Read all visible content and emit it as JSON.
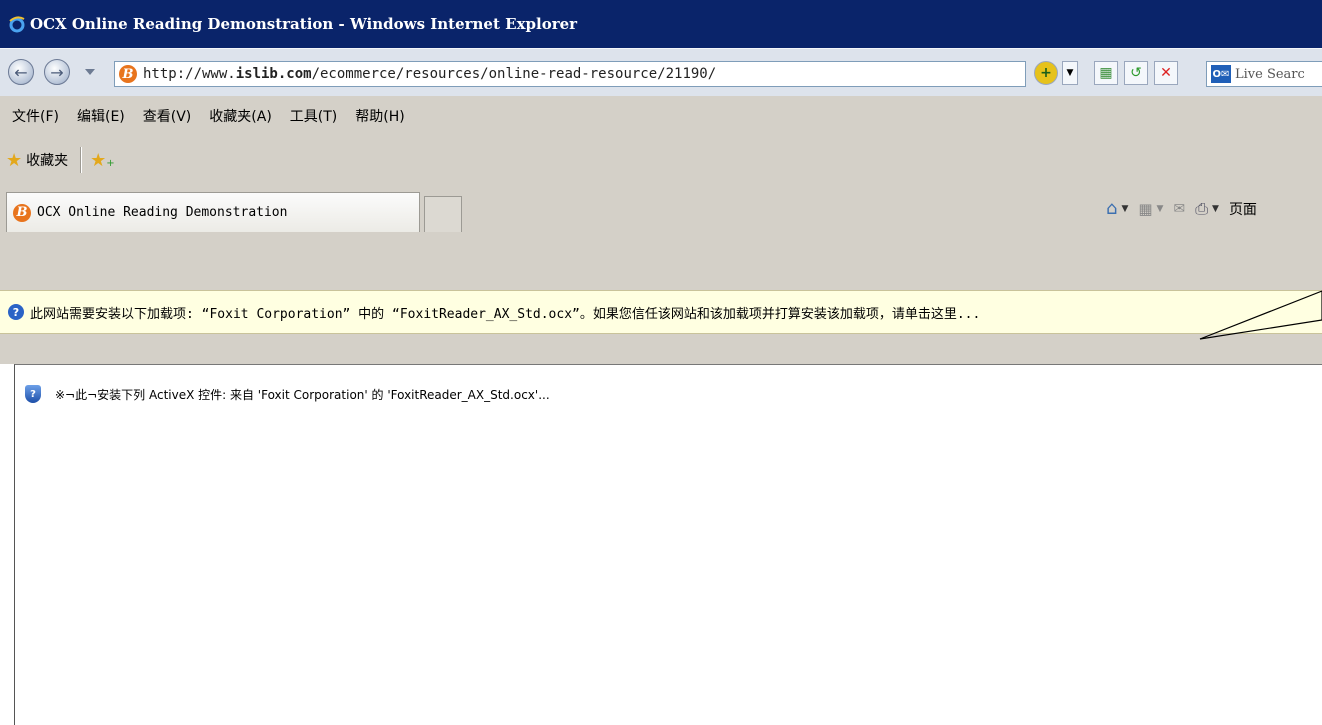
{
  "window": {
    "title": "OCX Online Reading Demonstration - Windows Internet Explorer",
    "logo_icon": "ie-logo-icon"
  },
  "address_bar": {
    "back_icon": "back-arrow-icon",
    "forward_icon": "forward-arrow-icon",
    "url_prefix": "http://www.",
    "url_bold": "islib.com",
    "url_rest": "/ecommerce/resources/online-read-resource/21190/",
    "search_placeholder": "Live Searc",
    "search_logo": "O✉"
  },
  "menu": {
    "items": [
      "文件(F)",
      "编辑(E)",
      "查看(V)",
      "收藏夹(A)",
      "工具(T)",
      "帮助(H)"
    ]
  },
  "favorites": {
    "label": "收藏夹"
  },
  "tabs": {
    "active_title": "OCX Online Reading Demonstration"
  },
  "command_bar": {
    "page_label": "页面"
  },
  "info_bar": {
    "text": "此网站需要安装以下加载项: “Foxit Corporation” 中的 “FoxitReader_AX_Std.ocx”。如果您信任该网站和该加载项并打算安装该加载项，请单击这里..."
  },
  "content": {
    "activex_text": "※¬此¬安装下列 ActiveX 控件: 来自 'Foxit Corporation' 的 'FoxitReader_AX_Std.ocx'..."
  },
  "colors": {
    "titlebar": "#0a246a",
    "infobar": "#ffffe1",
    "chrome": "#d4d0c8"
  }
}
